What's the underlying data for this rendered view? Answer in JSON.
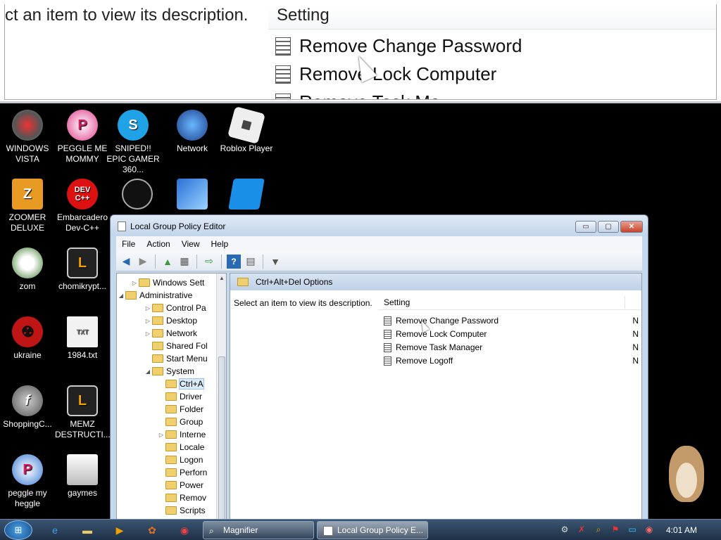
{
  "magnifier": {
    "description_text": "ct an item to view its description.",
    "column_header": "Setting",
    "rows": [
      "Remove Change Password",
      "Remove Lock Computer",
      "Remove Task Ma"
    ]
  },
  "desktop_icons": [
    {
      "label": "WINDOWS VISTA",
      "icon": "orb-icon"
    },
    {
      "label": "PEGGLE ME MOMMY",
      "icon": "peggle-icon"
    },
    {
      "label": "SNIPED!! EPIC GAMER 360...",
      "icon": "skype-icon"
    },
    {
      "label": "Network",
      "icon": "network-icon"
    },
    {
      "label": "Roblox Player",
      "icon": "roblox-icon"
    },
    {
      "label": "ZOOMER DELUXE",
      "icon": "zoomer-icon"
    },
    {
      "label": "Embarcadero Dev-C++",
      "icon": "devcpp-icon",
      "glyph": "DEV C++"
    },
    {
      "label": "",
      "icon": "round-black-icon"
    },
    {
      "label": "",
      "icon": "monitor-icon"
    },
    {
      "label": "",
      "icon": "roblox-studio-icon"
    },
    {
      "label": "zom",
      "icon": "flower-icon"
    },
    {
      "label": "chomikrypt...",
      "icon": "clock-app-icon"
    },
    {
      "label": "ukraine",
      "icon": "radiation-icon"
    },
    {
      "label": "1984.txt",
      "icon": "text-file-icon",
      "glyph": "TXT"
    },
    {
      "label": "ShoppingC...",
      "icon": "flash-icon"
    },
    {
      "label": "MEMZ DESTRUCTI...",
      "icon": "clock-app-icon"
    },
    {
      "label": "peggle my heggle",
      "icon": "peggle-icon"
    },
    {
      "label": "gaymes",
      "icon": "folder-icon"
    }
  ],
  "window": {
    "title": "Local Group Policy Editor",
    "buttons": {
      "minimize": "▭",
      "maximize": "▢",
      "close": "✕"
    },
    "menu": [
      "File",
      "Action",
      "View",
      "Help"
    ],
    "tree": [
      {
        "label": "Windows Sett",
        "arrow": "▷",
        "indent": 1
      },
      {
        "label": "Administrative",
        "arrow": "◢",
        "indent": 0
      },
      {
        "label": "Control Pa",
        "arrow": "▷",
        "indent": 2
      },
      {
        "label": "Desktop",
        "arrow": "▷",
        "indent": 2
      },
      {
        "label": "Network",
        "arrow": "▷",
        "indent": 2
      },
      {
        "label": "Shared Fol",
        "arrow": "",
        "indent": 2
      },
      {
        "label": "Start Menu",
        "arrow": "",
        "indent": 2
      },
      {
        "label": "System",
        "arrow": "◢",
        "indent": 2
      },
      {
        "label": "Ctrl+A",
        "arrow": "",
        "indent": 3,
        "selected": true
      },
      {
        "label": "Driver",
        "arrow": "",
        "indent": 3
      },
      {
        "label": "Folder",
        "arrow": "",
        "indent": 3
      },
      {
        "label": "Group",
        "arrow": "",
        "indent": 3
      },
      {
        "label": "Interne",
        "arrow": "▷",
        "indent": 3
      },
      {
        "label": "Locale",
        "arrow": "",
        "indent": 3
      },
      {
        "label": "Logon",
        "arrow": "",
        "indent": 3
      },
      {
        "label": "Perforn",
        "arrow": "",
        "indent": 3
      },
      {
        "label": "Power",
        "arrow": "",
        "indent": 3
      },
      {
        "label": "Remov",
        "arrow": "",
        "indent": 3
      },
      {
        "label": "Scripts",
        "arrow": "",
        "indent": 3
      }
    ],
    "right_header": "Ctrl+Alt+Del Options",
    "description": "Select an item to view its description.",
    "column_setting": "Setting",
    "settings": [
      {
        "name": "Remove Change Password",
        "state": "N"
      },
      {
        "name": "Remove Lock Computer",
        "state": "N"
      },
      {
        "name": "Remove Task Manager",
        "state": "N"
      },
      {
        "name": "Remove Logoff",
        "state": "N"
      }
    ]
  },
  "taskbar": {
    "tasks": [
      {
        "label": "Magnifier",
        "icon": "magnifier-icon"
      },
      {
        "label": "Local Group Policy E...",
        "icon": "policy-icon"
      }
    ],
    "clock": "4:01 AM"
  }
}
